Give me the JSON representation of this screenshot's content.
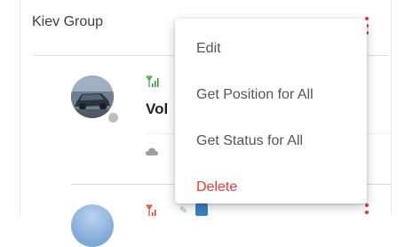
{
  "group": {
    "title": "Kiev Group"
  },
  "vehicle": {
    "name": "Vol",
    "signal_color": "#2e9e3a",
    "status_color": "#bdbdbd"
  },
  "next_vehicle": {
    "signal_color": "#e53935",
    "badge_color": "#3b82c4"
  },
  "menu": {
    "items": [
      {
        "label": "Edit",
        "color": "#555555"
      },
      {
        "label": "Get Position for All",
        "color": "#555555"
      },
      {
        "label": "Get Status for All",
        "color": "#555555"
      },
      {
        "label": "Delete",
        "color": "#e53935"
      }
    ]
  },
  "icons": {
    "signal": "signal-icon",
    "cloud": "cloud-icon",
    "kebab": "kebab-menu-icon",
    "wrench": "wrench-icon"
  }
}
